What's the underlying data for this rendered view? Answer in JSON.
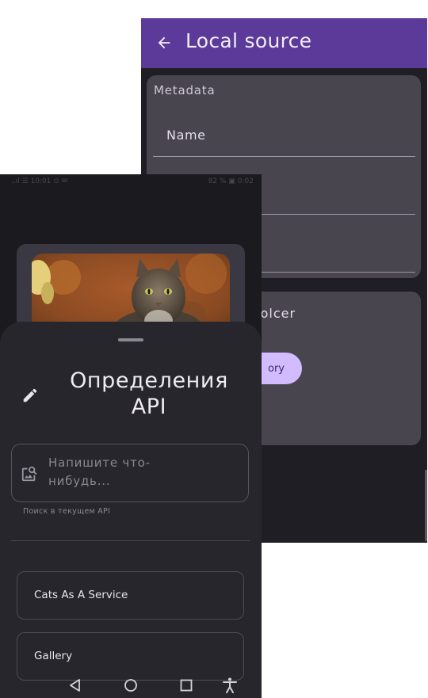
{
  "back_screen": {
    "title": "Local source",
    "metadata_label": "Metadata",
    "name_field_label": "Name",
    "folder_label": "folcer",
    "directory_button_label": "ory"
  },
  "front_screen": {
    "status_bar": {
      "left": "..ıl ☰ 10:01 ⊙ ✉",
      "right": "82 % ▣ 0:02"
    },
    "sheet": {
      "title": "Определения API",
      "search_placeholder": "Напишите что-нибудь...",
      "search_helper": "Поиск в текущем API",
      "apis": [
        {
          "label": "Cats As A Service"
        },
        {
          "label": "Gallery"
        }
      ]
    }
  },
  "colors": {
    "app_bar": "#5b3a9a",
    "accent_button": "#d2bcff",
    "sheet_bg": "#27262d",
    "card_bg": "#48454f"
  },
  "icons": [
    "arrow-back-icon",
    "edit-icon",
    "image-search-icon",
    "nav-back-icon",
    "nav-home-icon",
    "nav-recents-icon",
    "accessibility-icon"
  ]
}
